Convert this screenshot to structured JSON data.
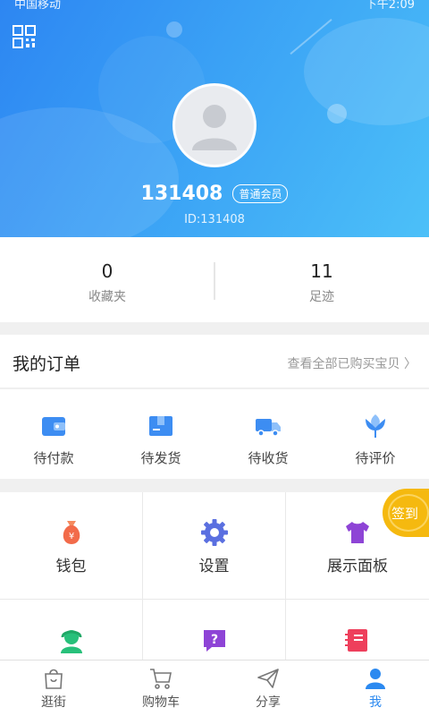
{
  "status_bar": {
    "left": "中国移动",
    "right": "下午2:09"
  },
  "profile": {
    "name": "131408",
    "badge": "普通会员",
    "id_text": "ID:131408"
  },
  "stats": [
    {
      "count": "0",
      "label": "收藏夹"
    },
    {
      "count": "11",
      "label": "足迹"
    }
  ],
  "orders": {
    "title": "我的订单",
    "view_all": "查看全部已购买宝贝 〉",
    "items": [
      {
        "label": "待付款",
        "icon": "wallet-icon"
      },
      {
        "label": "待发货",
        "icon": "box-icon"
      },
      {
        "label": "待收货",
        "icon": "truck-icon"
      },
      {
        "label": "待评价",
        "icon": "flower-icon"
      }
    ]
  },
  "grid": [
    {
      "label": "钱包",
      "icon": "money-bag-icon",
      "color": "#f26b4a"
    },
    {
      "label": "设置",
      "icon": "gear-icon",
      "color": "#5a6fe0"
    },
    {
      "label": "展示面板",
      "icon": "tshirt-icon",
      "color": "#8e44d6"
    },
    {
      "label": "",
      "icon": "customer-service-icon",
      "color": "#27c07a"
    },
    {
      "label": "",
      "icon": "help-icon",
      "color": "#8e44d6"
    },
    {
      "label": "",
      "icon": "card-icon",
      "color": "#ee3f5c"
    }
  ],
  "signin": {
    "label": "签到",
    "color": "#f5b90f"
  },
  "tabbar": [
    {
      "label": "逛街",
      "icon": "shopping-bag-icon",
      "active": false
    },
    {
      "label": "购物车",
      "icon": "cart-icon",
      "active": false
    },
    {
      "label": "分享",
      "icon": "paper-plane-icon",
      "active": false
    },
    {
      "label": "我",
      "icon": "person-icon",
      "active": true
    }
  ],
  "colors": {
    "accent": "#2b89f0",
    "header_start": "#2d86f2",
    "header_end": "#4cc0f8"
  }
}
